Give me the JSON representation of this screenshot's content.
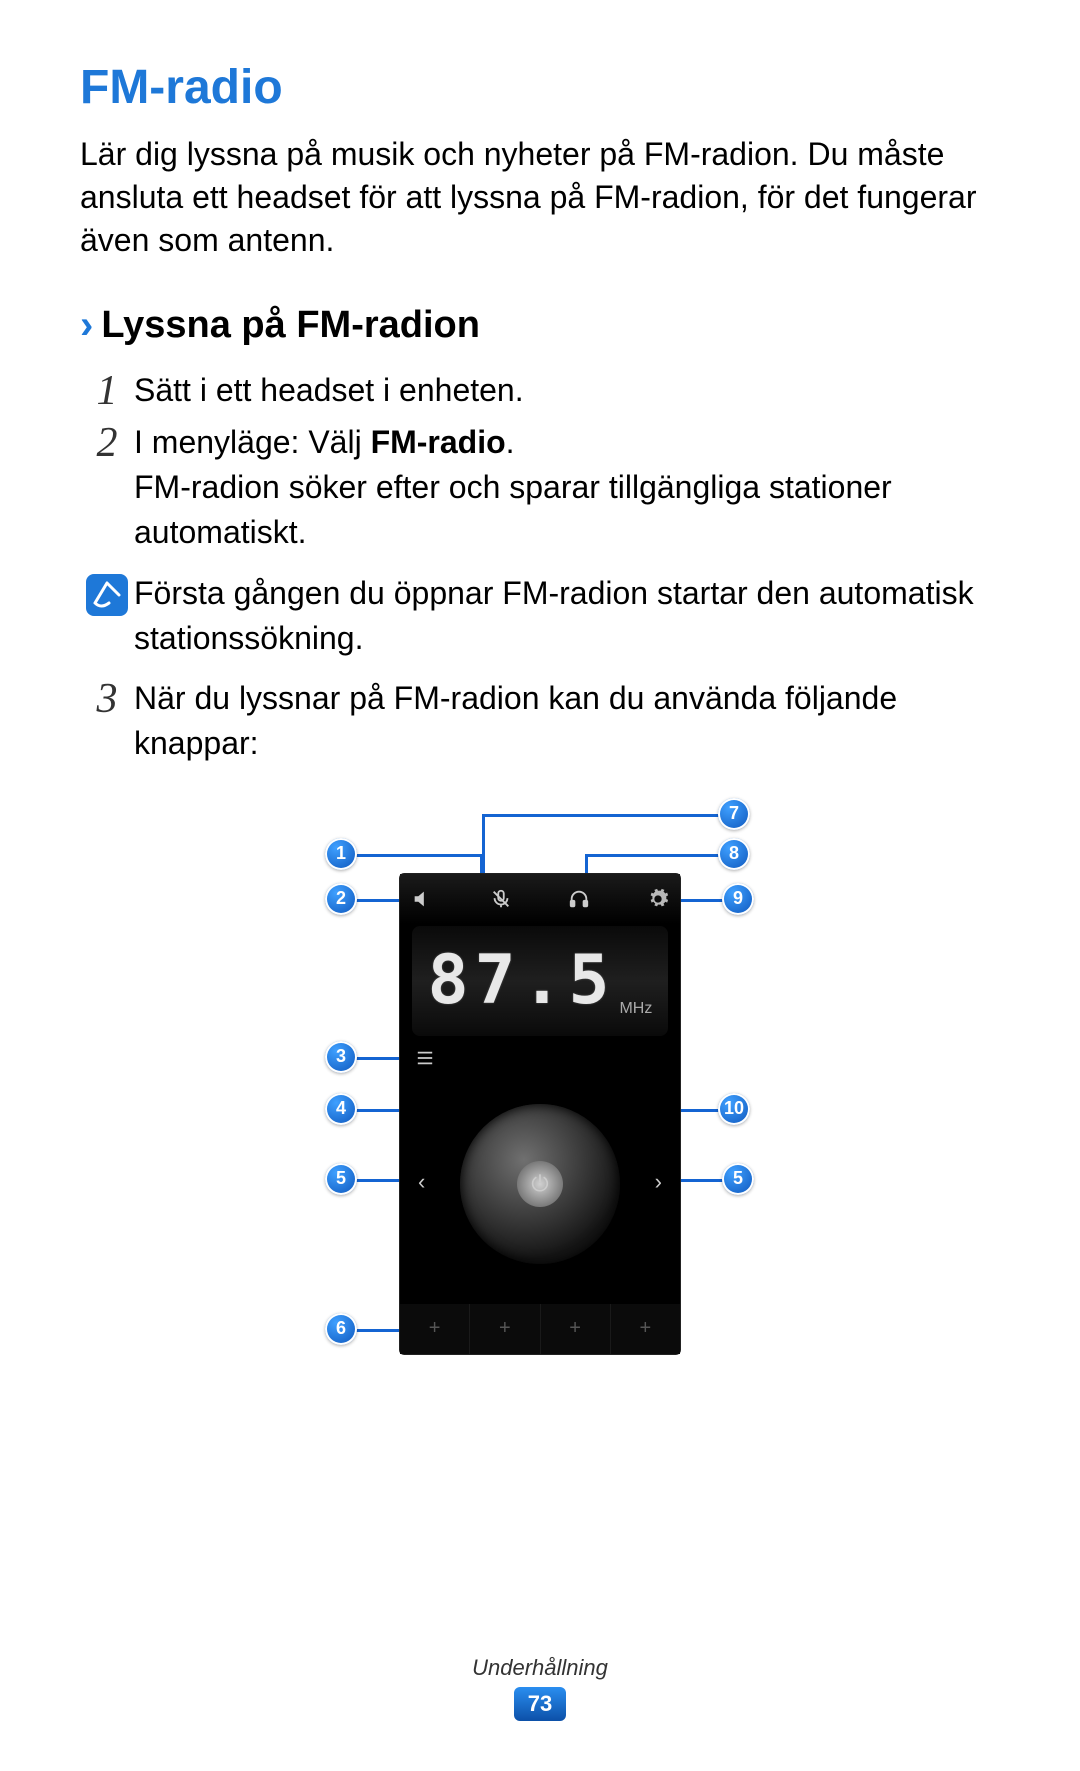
{
  "title": "FM-radio",
  "intro": "Lär dig lyssna på musik och nyheter på FM-radion. Du måste ansluta ett headset för att lyssna på FM-radion, för det fungerar även som antenn.",
  "chevron": "›",
  "subheading": "Lyssna på FM-radion",
  "steps": {
    "s1_num": "1",
    "s1_text": "Sätt i ett headset i enheten.",
    "s2_num": "2",
    "s2_lead": "I menyläge: Välj ",
    "s2_bold": "FM-radio",
    "s2_tail": ".",
    "s2_sub": "FM-radion söker efter och sparar tillgängliga stationer automatiskt.",
    "s3_num": "3",
    "s3_text": "När du lyssnar på FM-radion kan du använda följande knappar:"
  },
  "note": "Första gången du öppnar FM-radion startar den automatisk stationssökning.",
  "radio": {
    "frequency": "87.5",
    "unit": "MHz",
    "preset_plus": "+",
    "seek_left": "‹",
    "seek_right": "›",
    "power_glyph": "⏻"
  },
  "callouts": {
    "c1": "1",
    "c2": "2",
    "c3": "3",
    "c4": "4",
    "c5": "5",
    "c6": "6",
    "c7": "7",
    "c8": "8",
    "c9": "9",
    "c10": "10"
  },
  "footer": {
    "section": "Underhållning",
    "page": "73"
  }
}
